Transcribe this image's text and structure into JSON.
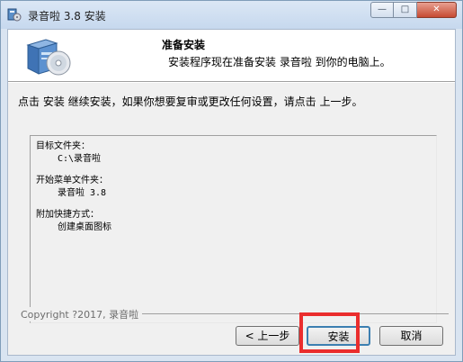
{
  "window": {
    "title": "录音啦 3.8 安装",
    "controls": {
      "minimize": "—",
      "maximize": "□",
      "close": "✕"
    }
  },
  "header": {
    "title": "准备安装",
    "subtitle": "安装程序现在准备安装 录音啦 到你的电脑上。"
  },
  "instruction": "点击 安装 继续安装，如果你想要复审或更改任何设置，请点击 上一步。",
  "summary": {
    "target_folder_label": "目标文件夹：",
    "target_folder_value": "C:\\录音啦",
    "start_menu_label": "开始菜单文件夹：",
    "start_menu_value": "录音啦 3.8",
    "shortcuts_label": "附加快捷方式：",
    "shortcuts_value": "创建桌面图标"
  },
  "footer": {
    "copyright": "Copyright ?2017, 录音啦"
  },
  "buttons": {
    "back": "< 上一步",
    "install": "安装",
    "cancel": "取消"
  },
  "colors": {
    "highlight": "#ea2d2d",
    "default_button_border": "#3c7fb1"
  },
  "icons": {
    "app": "installer-app-icon",
    "setup": "setup-box-cd-icon"
  }
}
